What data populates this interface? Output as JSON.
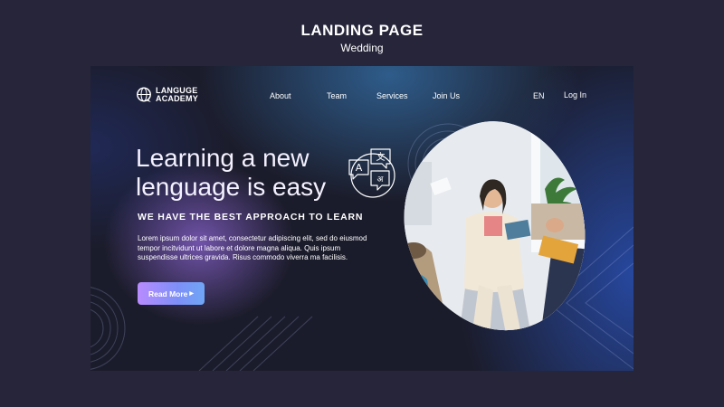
{
  "header": {
    "title": "LANDING PAGE",
    "subtitle": "Wedding"
  },
  "brand": {
    "line1": "LANGUGE",
    "line2": "ACADEMY"
  },
  "nav": {
    "items": [
      {
        "label": "About"
      },
      {
        "label": "Team"
      },
      {
        "label": "Services"
      },
      {
        "label": "Join Us"
      }
    ],
    "language": "EN",
    "login": "Log In"
  },
  "hero": {
    "title_line1": "Learning a new",
    "title_line2": "lenguage is easy",
    "tagline": "WE HAVE THE BEST APPROACH TO LEARN",
    "body": "Lorem ipsum dolor sit amet, consectetur adipiscing elit, sed do eiusmod tempor incitvidunt ut labore et dolore magna aliqua. Quis ipsum suspendisse ultrices gravida. Risus commodo viverra ma facilisis.",
    "cta_label": "Read More",
    "icon": "translate-bubbles-icon"
  },
  "colors": {
    "page_bg": "#26253a",
    "panel_bg": "#1b1c2b",
    "accent_purple": "#b88cff",
    "accent_blue": "#6fa6f6"
  }
}
